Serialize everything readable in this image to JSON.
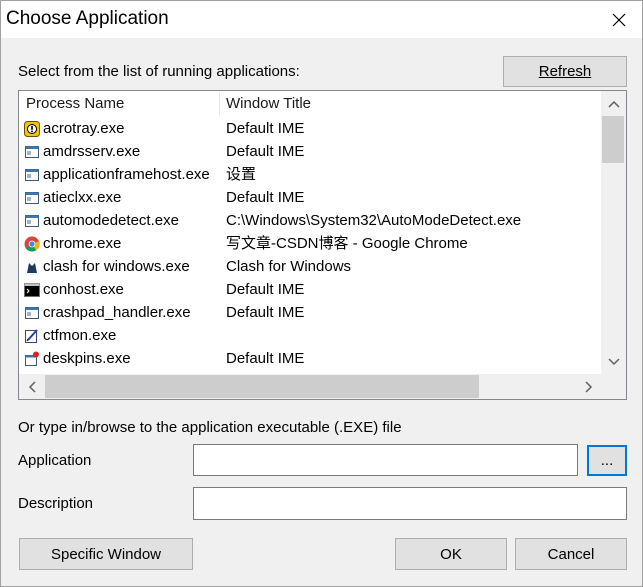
{
  "window": {
    "title": "Choose Application"
  },
  "labels": {
    "select_prompt": "Select from the list of running applications:",
    "type_prompt": "Or type in/browse to the application executable (.EXE) file",
    "application": "Application",
    "description": "Description"
  },
  "buttons": {
    "refresh": "Refresh",
    "browse": "...",
    "specific_window": "Specific Window",
    "ok": "OK",
    "cancel": "Cancel"
  },
  "list": {
    "columns": [
      "Process Name",
      "Window Title"
    ],
    "rows": [
      {
        "process": "acrotray.exe",
        "title": "Default IME",
        "icon": "acrotray-icon"
      },
      {
        "process": "amdrsserv.exe",
        "title": "Default IME",
        "icon": "window-app-icon"
      },
      {
        "process": "applicationframehost.exe",
        "title": "设置",
        "icon": "window-app-icon"
      },
      {
        "process": "atieclxx.exe",
        "title": "Default IME",
        "icon": "window-app-icon"
      },
      {
        "process": "automodedetect.exe",
        "title": "C:\\Windows\\System32\\AutoModeDetect.exe",
        "icon": "window-app-icon"
      },
      {
        "process": "chrome.exe",
        "title": "写文章-CSDN博客 - Google Chrome",
        "icon": "chrome-icon"
      },
      {
        "process": "clash for windows.exe",
        "title": "Clash for Windows",
        "icon": "clash-icon"
      },
      {
        "process": "conhost.exe",
        "title": "Default IME",
        "icon": "console-icon"
      },
      {
        "process": "crashpad_handler.exe",
        "title": "Default IME",
        "icon": "window-app-icon"
      },
      {
        "process": "ctfmon.exe",
        "title": "",
        "icon": "ctfmon-icon"
      },
      {
        "process": "deskpins.exe",
        "title": "Default IME",
        "icon": "deskpins-icon"
      }
    ]
  },
  "fields": {
    "application_value": "",
    "description_value": ""
  },
  "colors": {
    "accent": "#0078d7",
    "button_face": "#e1e1e1",
    "dialog_bg": "#f0f0f0"
  }
}
